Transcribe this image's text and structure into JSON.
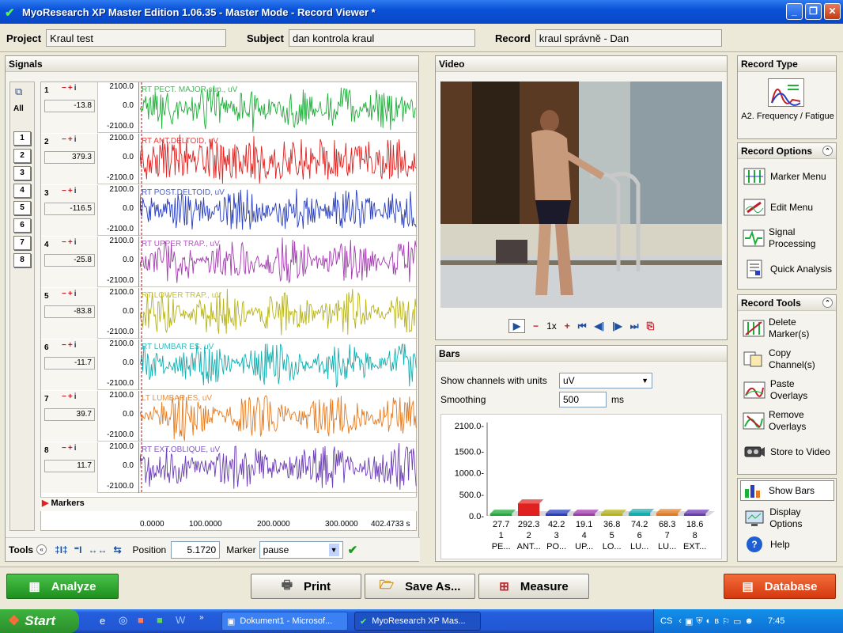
{
  "title": "MyoResearch XP Master Edition 1.06.35 - Master Mode - Record Viewer *",
  "window_buttons": {
    "minimize": "_",
    "maximize": "❐",
    "close": "✕"
  },
  "info": {
    "project_label": "Project",
    "project_value": "Kraul test",
    "subject_label": "Subject",
    "subject_value": "dan kontrola kraul",
    "record_label": "Record",
    "record_value": "kraul správně - Dan"
  },
  "signals": {
    "header": "Signals",
    "all_label": "All",
    "channel_buttons": [
      "1",
      "2",
      "3",
      "4",
      "5",
      "6",
      "7",
      "8"
    ],
    "y_top": "2100.0",
    "y_mid": "0.0",
    "y_bottom": "-2100.0",
    "channels": [
      {
        "num": "1",
        "value": "-13.8",
        "label": "RT PECT. MAJOR sup., uV",
        "color": "#1fae3a"
      },
      {
        "num": "2",
        "value": "379.3",
        "label": "RT ANT.DELTOID, uV",
        "color": "#e0211f"
      },
      {
        "num": "3",
        "value": "-116.5",
        "label": "RT POST.DELTOID, uV",
        "color": "#2a3fbf"
      },
      {
        "num": "4",
        "value": "-25.8",
        "label": "RT UPPER TRAP., uV",
        "color": "#a43bb0"
      },
      {
        "num": "5",
        "value": "-83.8",
        "label": "RT LOWER TRAP., uV",
        "color": "#b8b419"
      },
      {
        "num": "6",
        "value": "-11.7",
        "label": "RT LUMBAR ES, uV",
        "color": "#12aeb0"
      },
      {
        "num": "7",
        "value": "39.7",
        "label": "LT LUMBAR ES, uV",
        "color": "#e67a1e"
      },
      {
        "num": "8",
        "value": "11.7",
        "label": "RT EXT.OBLIQUE, uV",
        "color": "#6b3cb5"
      }
    ],
    "markers_label": "Markers",
    "x_ticks": [
      "0.0000",
      "100.0000",
      "200.0000",
      "300.0000",
      "402.4733 s"
    ]
  },
  "tools": {
    "label": "Tools",
    "position_label": "Position",
    "position_value": "5.1720",
    "marker_label": "Marker",
    "marker_value": "pause"
  },
  "video": {
    "header": "Video",
    "speed": "1x"
  },
  "bars": {
    "header": "Bars",
    "units_label": "Show channels with units",
    "units_value": "uV",
    "smoothing_label": "Smoothing",
    "smoothing_value": "500",
    "smoothing_unit": "ms",
    "y_ticks": [
      "2100.0-",
      "1500.0-",
      "1000.0-",
      "500.0-",
      "0.0-"
    ]
  },
  "chart_data": {
    "type": "bar",
    "categories": [
      "1",
      "2",
      "3",
      "4",
      "5",
      "6",
      "7",
      "8"
    ],
    "category_labels": [
      "PE...",
      "ANT...",
      "PO...",
      "UP...",
      "LO...",
      "LU...",
      "LU...",
      "EXT..."
    ],
    "values": [
      27.7,
      292.3,
      42.2,
      19.1,
      36.8,
      74.2,
      68.3,
      18.6
    ],
    "value_labels": [
      "27.7",
      "292.3",
      "42.2",
      "19.1",
      "36.8",
      "74.2",
      "68.3",
      "18.6"
    ],
    "colors": [
      "#1fae3a",
      "#e0211f",
      "#2a3fbf",
      "#a43bb0",
      "#b8b419",
      "#12aeb0",
      "#e67a1e",
      "#6b3cb5"
    ],
    "ylim": [
      0,
      2100
    ],
    "ytick_values": [
      2100,
      1500,
      1000,
      500,
      0
    ]
  },
  "record_type": {
    "header": "Record Type",
    "value": "A2. Frequency / Fatigue"
  },
  "record_options": {
    "header": "Record Options",
    "items": [
      {
        "label": "Marker Menu",
        "icon": "marker-menu-icon"
      },
      {
        "label": "Edit Menu",
        "icon": "edit-menu-icon"
      },
      {
        "label": "Signal Processing",
        "icon": "signal-processing-icon"
      },
      {
        "label": "Quick Analysis",
        "icon": "quick-analysis-icon"
      }
    ]
  },
  "record_tools": {
    "header": "Record Tools",
    "items": [
      {
        "label": "Delete Marker(s)",
        "icon": "delete-markers-icon"
      },
      {
        "label": "Copy Channel(s)",
        "icon": "copy-channels-icon"
      },
      {
        "label": "Paste Overlays",
        "icon": "paste-overlays-icon"
      },
      {
        "label": "Remove Overlays",
        "icon": "remove-overlays-icon"
      },
      {
        "label": "Store to Video",
        "icon": "store-video-icon"
      }
    ]
  },
  "view_options": {
    "items": [
      {
        "label": "Show Bars",
        "icon": "show-bars-icon"
      },
      {
        "label": "Display Options",
        "icon": "display-options-icon"
      },
      {
        "label": "Help",
        "icon": "help-icon"
      }
    ]
  },
  "bottom": {
    "analyze": "Analyze",
    "print": "Print",
    "save_as": "Save As...",
    "measure": "Measure",
    "database": "Database"
  },
  "taskbar": {
    "start": "Start",
    "task1": "Dokument1 - Microsof...",
    "task2": "MyoResearch XP Mas...",
    "lang": "CS",
    "clock": "7:45"
  }
}
